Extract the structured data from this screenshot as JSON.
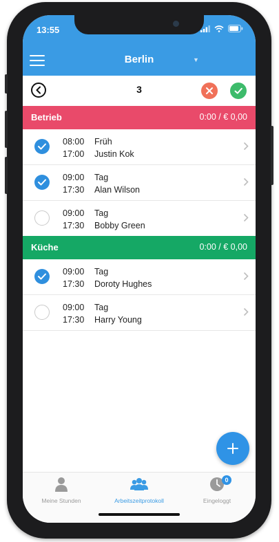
{
  "status_bar": {
    "time": "13:55"
  },
  "header": {
    "title": "Berlin"
  },
  "toolbar": {
    "count": "3"
  },
  "colors": {
    "accent": "#3a9be4",
    "betrieb": "#e94a6a",
    "kueche": "#15a865",
    "reject": "#f07159",
    "accept": "#3dbb6b"
  },
  "sections": [
    {
      "name": "Betrieb",
      "summary": "0:00 / € 0,00",
      "rows": [
        {
          "start": "08:00",
          "end": "17:00",
          "shift": "Früh",
          "person": "Justin Kok",
          "checked": true
        },
        {
          "start": "09:00",
          "end": "17:30",
          "shift": "Tag",
          "person": "Alan Wilson",
          "checked": true
        },
        {
          "start": "09:00",
          "end": "17:30",
          "shift": "Tag",
          "person": "Bobby Green",
          "checked": false
        }
      ]
    },
    {
      "name": "Küche",
      "summary": "0:00 / € 0,00",
      "rows": [
        {
          "start": "09:00",
          "end": "17:30",
          "shift": "Tag",
          "person": "Doroty Hughes",
          "checked": true
        },
        {
          "start": "09:00",
          "end": "17:30",
          "shift": "Tag",
          "person": "Harry Young",
          "checked": false
        }
      ]
    }
  ],
  "tabbar": {
    "items": [
      {
        "label": "Meine Stunden",
        "icon": "person-icon",
        "active": false
      },
      {
        "label": "Arbeitszeitprotokoll",
        "icon": "team-icon",
        "active": true
      },
      {
        "label": "Eingeloggt",
        "icon": "clock-icon",
        "active": false,
        "badge": "0"
      }
    ]
  }
}
